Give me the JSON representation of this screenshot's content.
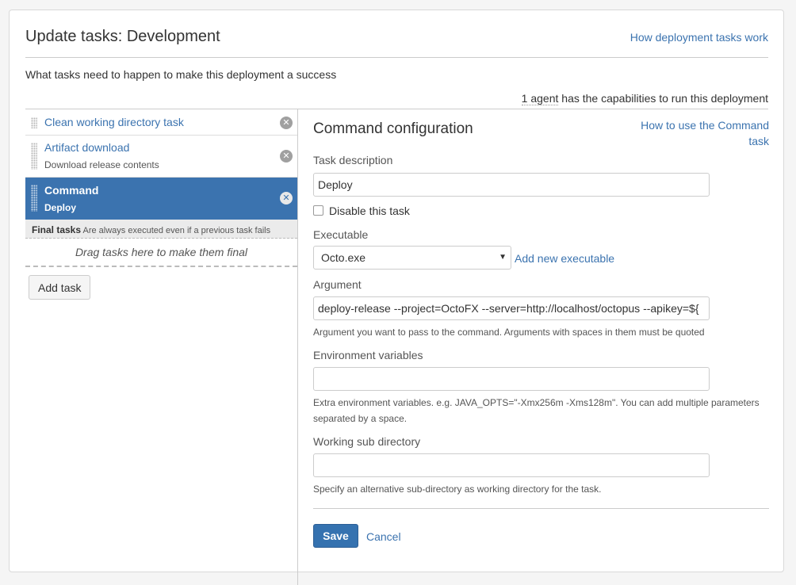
{
  "header": {
    "title": "Update tasks: Development",
    "help_link": "How deployment tasks work",
    "subtitle": "What tasks need to happen to make this deployment a success",
    "agents_count": "1 agent",
    "agents_text": " has the capabilities to run this deployment"
  },
  "tasks": [
    {
      "name": "Clean working directory task",
      "desc": ""
    },
    {
      "name": "Artifact download",
      "desc": "Download release contents"
    },
    {
      "name": "Command",
      "desc": "Deploy"
    }
  ],
  "final": {
    "label": "Final tasks",
    "text": "Are always executed even if a previous task fails",
    "drag_hint": "Drag tasks here to make them final"
  },
  "add_task_label": "Add task",
  "config": {
    "title": "Command configuration",
    "help_link": "How to use the Command task",
    "task_description_label": "Task description",
    "task_description_value": "Deploy",
    "disable_label": "Disable this task",
    "executable_label": "Executable",
    "executable_value": "Octo.exe",
    "add_executable": "Add new executable",
    "argument_label": "Argument",
    "argument_value": "deploy-release --project=OctoFX --server=http://localhost/octopus --apikey=${",
    "argument_hint": "Argument you want to pass to the command. Arguments with spaces in them must be quoted",
    "env_label": "Environment variables",
    "env_value": "",
    "env_hint": "Extra environment variables. e.g. JAVA_OPTS=\"-Xmx256m -Xms128m\". You can add multiple parameters separated by a space.",
    "workdir_label": "Working sub directory",
    "workdir_value": "",
    "workdir_hint": "Specify an alternative sub-directory as working directory for the task.",
    "save_label": "Save",
    "cancel_label": "Cancel"
  },
  "colors": {
    "accent": "#3b73af",
    "selected_bg": "#3b73af",
    "save_bg": "#3572b0"
  }
}
